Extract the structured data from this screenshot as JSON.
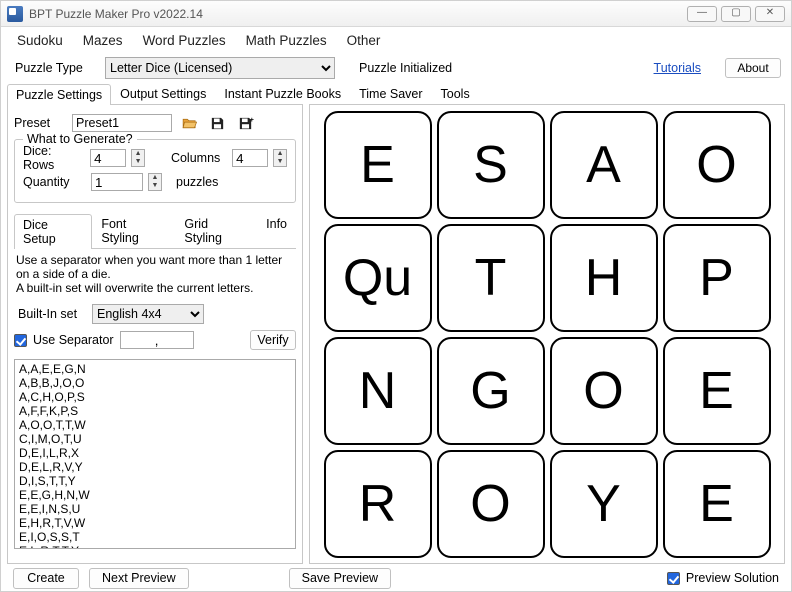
{
  "window": {
    "title": "BPT Puzzle Maker Pro v2022.14",
    "btn_min": "—",
    "btn_max": "▢",
    "btn_close": "✕"
  },
  "menubar": [
    "Sudoku",
    "Mazes",
    "Word Puzzles",
    "Math Puzzles",
    "Other"
  ],
  "top": {
    "puzzle_type_label": "Puzzle Type",
    "puzzle_type_value": "Letter Dice (Licensed)",
    "status": "Puzzle Initialized",
    "tutorials": "Tutorials",
    "about": "About"
  },
  "main_tabs": [
    "Puzzle Settings",
    "Output Settings",
    "Instant Puzzle Books",
    "Time Saver",
    "Tools"
  ],
  "active_main_tab": 0,
  "preset": {
    "label": "Preset",
    "value": "Preset1"
  },
  "generate": {
    "legend": "What to Generate?",
    "rows_label": "Dice: Rows",
    "rows_value": "4",
    "cols_label": "Columns",
    "cols_value": "4",
    "qty_label": "Quantity",
    "qty_value": "1",
    "qty_suffix": "puzzles"
  },
  "sub_tabs": [
    "Dice Setup",
    "Font Styling",
    "Grid Styling",
    "Info"
  ],
  "active_sub_tab": 0,
  "dice_setup": {
    "help1": "Use a separator when you want more than 1 letter on a side of a die.",
    "help2": "A built-in set will overwrite the current letters.",
    "builtin_label": "Built-In set",
    "builtin_value": "English 4x4",
    "use_sep_label": "Use Separator",
    "sep_value": ",",
    "verify": "Verify",
    "dice_list": "A,A,E,E,G,N\nA,B,B,J,O,O\nA,C,H,O,P,S\nA,F,F,K,P,S\nA,O,O,T,T,W\nC,I,M,O,T,U\nD,E,I,L,R,X\nD,E,L,R,V,Y\nD,I,S,T,T,Y\nE,E,G,H,N,W\nE,E,I,N,S,U\nE,H,R,T,V,W\nE,I,O,S,S,T\nE,L,R,T,T,Y"
  },
  "preview_grid": [
    [
      "E",
      "S",
      "A",
      "O"
    ],
    [
      "Qu",
      "T",
      "H",
      "P"
    ],
    [
      "N",
      "G",
      "O",
      "E"
    ],
    [
      "R",
      "O",
      "Y",
      "E"
    ]
  ],
  "bottom": {
    "create": "Create",
    "next": "Next Preview",
    "save": "Save Preview",
    "preview_solution": "Preview Solution"
  }
}
